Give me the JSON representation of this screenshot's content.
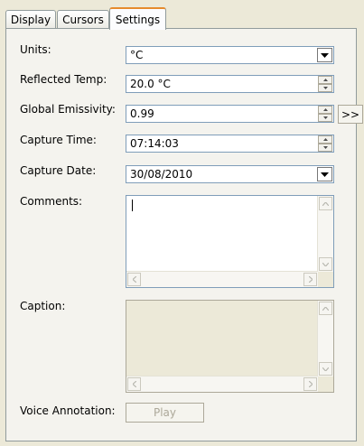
{
  "tabs": [
    {
      "label": "Display"
    },
    {
      "label": "Cursors"
    },
    {
      "label": "Settings"
    }
  ],
  "settings": {
    "units": {
      "label": "Units:",
      "value": "°C"
    },
    "reflected_temp": {
      "label": "Reflected Temp:",
      "value": "20.0 °C"
    },
    "global_emissivity": {
      "label": "Global Emissivity:",
      "value": "0.99",
      "more_button": ">>"
    },
    "capture_time": {
      "label": "Capture Time:",
      "value": "07:14:03"
    },
    "capture_date": {
      "label": "Capture Date:",
      "value": "30/08/2010"
    },
    "comments": {
      "label": "Comments:",
      "value": ""
    },
    "caption": {
      "label": "Caption:",
      "value": ""
    },
    "voice_annotation": {
      "label": "Voice Annotation:",
      "play_button": "Play"
    }
  },
  "colors": {
    "active_tab_accent": "#e68b2c",
    "field_border": "#7f9db9",
    "panel_background": "#f4f3ee",
    "window_background": "#ece9d8"
  }
}
